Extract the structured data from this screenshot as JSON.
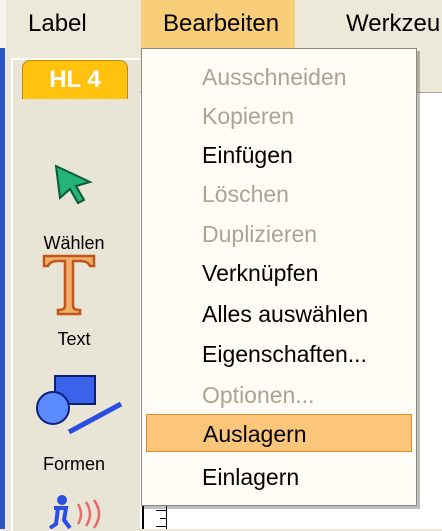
{
  "menubar": {
    "items": [
      "Label",
      "Bearbeiten",
      "Werkzeu"
    ],
    "active_index": 1
  },
  "toolpanel": {
    "tab_label": "HL 4",
    "tools": [
      {
        "label": "Wählen",
        "icon": "select-arrow-icon"
      },
      {
        "label": "Text",
        "icon": "text-t-icon"
      },
      {
        "label": "Formen",
        "icon": "shapes-icon"
      },
      {
        "label": "",
        "icon": "accessibility-sound-icon"
      }
    ]
  },
  "dropdown": {
    "items": [
      {
        "label": "Ausschneiden",
        "enabled": false
      },
      {
        "label": "Kopieren",
        "enabled": false
      },
      {
        "label": "Einfügen",
        "enabled": true
      },
      {
        "label": "Löschen",
        "enabled": false
      },
      {
        "label": "Duplizieren",
        "enabled": false
      },
      {
        "label": "Verknüpfen",
        "enabled": true
      },
      {
        "label": "Alles auswählen",
        "enabled": true
      },
      {
        "label": "Eigenschaften...",
        "enabled": true
      },
      {
        "label": "Optionen...",
        "enabled": false
      },
      {
        "label": "Auslagern",
        "enabled": true,
        "highlighted": true
      },
      {
        "label": "Einlagern",
        "enabled": true
      }
    ]
  },
  "colors": {
    "menu_highlight": "#f8ce78",
    "tab_yellow": "#ffc20e",
    "disabled_text": "#a8a596",
    "select_icon_green": "#26b37a",
    "text_icon_orange": "#e0852c",
    "shape_blue": "#2c4ee0"
  }
}
